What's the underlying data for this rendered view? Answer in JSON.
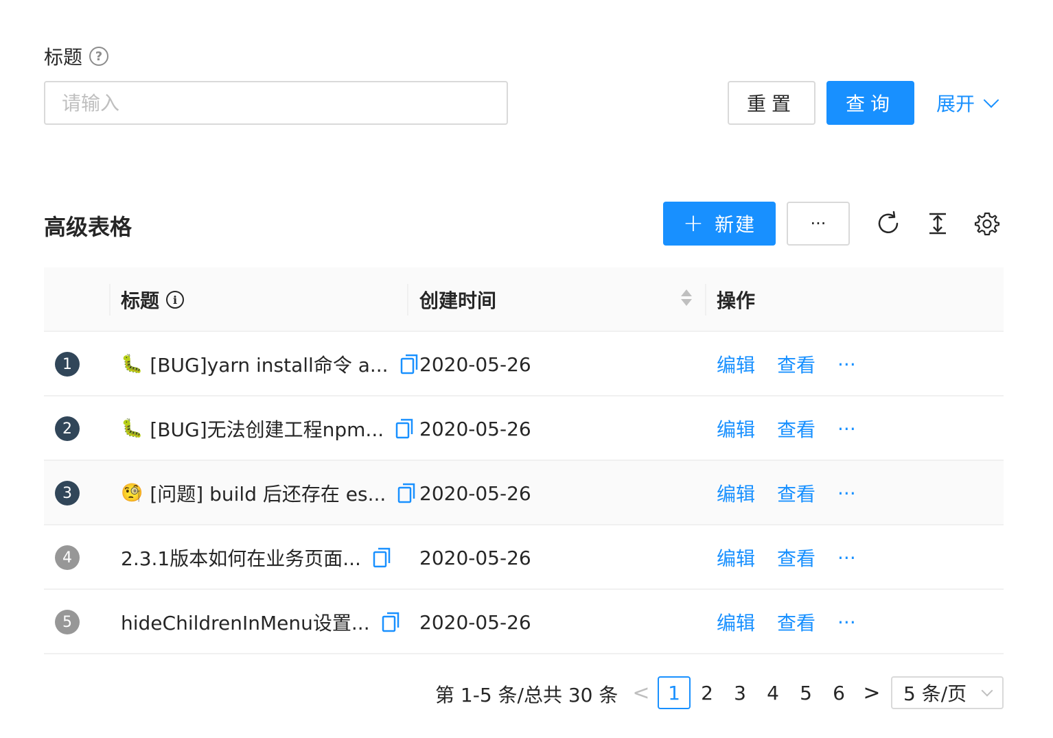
{
  "search": {
    "label": "标题",
    "placeholder": "请输入",
    "reset_label": "重置",
    "query_label": "查询",
    "expand_label": "展开"
  },
  "toolbar": {
    "title": "高级表格",
    "new_label": "新建",
    "more_label": "···"
  },
  "table": {
    "columns": {
      "title": "标题",
      "created": "创建时间",
      "ops": "操作"
    },
    "rows": [
      {
        "index": "1",
        "prefix": "🐛",
        "title": "[BUG]yarn install命令 a...",
        "date": "2020-05-26",
        "edit": "编辑",
        "view": "查看",
        "more": "···"
      },
      {
        "index": "2",
        "prefix": "🐛",
        "title": "[BUG]无法创建工程npm...",
        "date": "2020-05-26",
        "edit": "编辑",
        "view": "查看",
        "more": "···"
      },
      {
        "index": "3",
        "prefix": "🧐",
        "title": "[问题] build 后还存在 es...",
        "date": "2020-05-26",
        "edit": "编辑",
        "view": "查看",
        "more": "···"
      },
      {
        "index": "4",
        "prefix": "",
        "title": "2.3.1版本如何在业务页面...",
        "date": "2020-05-26",
        "edit": "编辑",
        "view": "查看",
        "more": "···"
      },
      {
        "index": "5",
        "prefix": "",
        "title": "hideChildrenInMenu设置...",
        "date": "2020-05-26",
        "edit": "编辑",
        "view": "查看",
        "more": "···"
      }
    ]
  },
  "pagination": {
    "total_text": "第 1-5 条/总共 30 条",
    "prev": "<",
    "next": ">",
    "pages": [
      "1",
      "2",
      "3",
      "4",
      "5",
      "6"
    ],
    "current": "1",
    "page_size": "5 条/页"
  },
  "colors": {
    "primary": "#1890ff",
    "index_dark": "#314659",
    "index_gray": "#979797"
  }
}
